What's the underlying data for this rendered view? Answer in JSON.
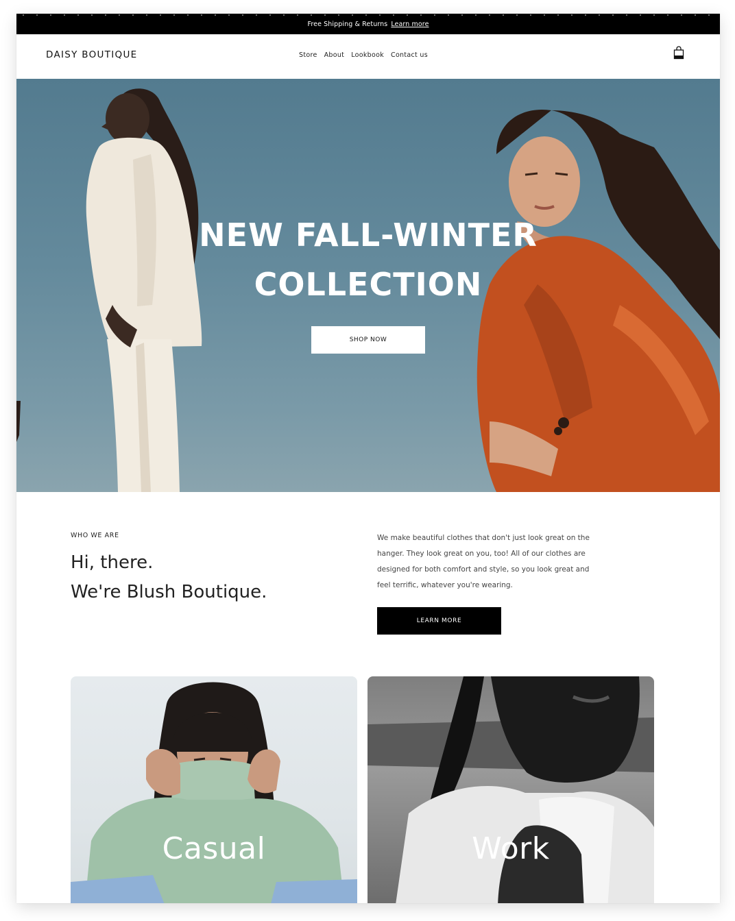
{
  "announcement": {
    "text": "Free Shipping & Returns",
    "link_label": "Learn more"
  },
  "header": {
    "brand": "DAISY BOUTIQUE",
    "nav": [
      {
        "label": "Store"
      },
      {
        "label": "About"
      },
      {
        "label": "Lookbook"
      },
      {
        "label": "Contact us"
      }
    ],
    "cart_icon": "shopping-bag-icon"
  },
  "hero": {
    "title_line1": "NEW FALL-WINTER",
    "title_line2": "COLLECTION",
    "cta_label": "SHOP NOW",
    "sky_color": "#5b8093",
    "suit_color_orange": "#c2501f",
    "suit_color_cream": "#efe8dc"
  },
  "about": {
    "eyebrow": "WHO WE ARE",
    "heading_line1": "Hi, there.",
    "heading_line2": "We're Blush Boutique.",
    "body": "We make beautiful clothes that don't just look great on the hanger. They look great on you, too! All of our clothes are designed for both comfort and style, so you look great and feel terrific, whatever you're wearing.",
    "cta_label": "LEARN MORE"
  },
  "categories": [
    {
      "label": "Casual"
    },
    {
      "label": "Work"
    }
  ]
}
